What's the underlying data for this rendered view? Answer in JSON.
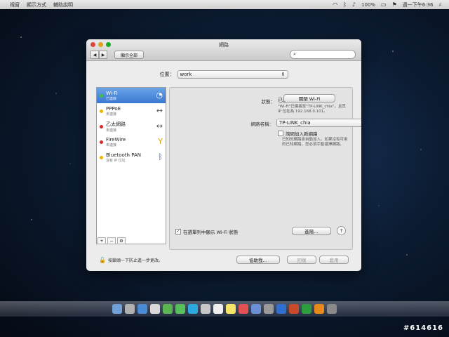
{
  "menubar": {
    "items": [
      "視窗",
      "顯示方式",
      "輔助說明"
    ],
    "battery": "100%",
    "clock": "週一下午6:36"
  },
  "window": {
    "title": "網路",
    "show_all": "顯示全部",
    "search_placeholder": ""
  },
  "location": {
    "label": "位置：",
    "value": "work"
  },
  "services": [
    {
      "name": "Wi-Fi",
      "status": "已連線",
      "color": "#3ec33e",
      "icon": "wifi-icon"
    },
    {
      "name": "PPPoE",
      "status": "未連接",
      "color": "#f0b400",
      "icon": "arrows-icon"
    },
    {
      "name": "乙太網路",
      "status": "未連接",
      "color": "#d22828",
      "icon": "arrows-icon"
    },
    {
      "name": "FireWire",
      "status": "未連接",
      "color": "#d22828",
      "icon": "firewire-icon"
    },
    {
      "name": "Bluetooth PAN",
      "status": "沒有 IP 位址",
      "color": "#f0b400",
      "icon": "bluetooth-icon"
    }
  ],
  "detail": {
    "status_label": "狀態：",
    "status_value": "已連線",
    "turn_off_button": "關閉 Wi-Fi",
    "status_description": "\"Wi-Fi\"已連接至\"TP-LINK_chia\"，且其 IP 位址為 192.168.0.101。",
    "network_name_label": "網路名稱：",
    "network_name_value": "TP-LINK_chia",
    "ask_join_label": "詢問加入新網路",
    "ask_join_description": "已知的網路會自動加入。如果沒有可用的已知網路，您必須手動選擇網路。",
    "show_menu_label": "在選單列中顯示 Wi-Fi 狀態",
    "advanced_button": "進階…",
    "help": "?"
  },
  "footer": {
    "lock_text": "按鎖頭一下防止進一步更改。",
    "assist_button": "協助我…",
    "revert_button": "回復",
    "apply_button": "套用"
  },
  "watermark": "#614616"
}
